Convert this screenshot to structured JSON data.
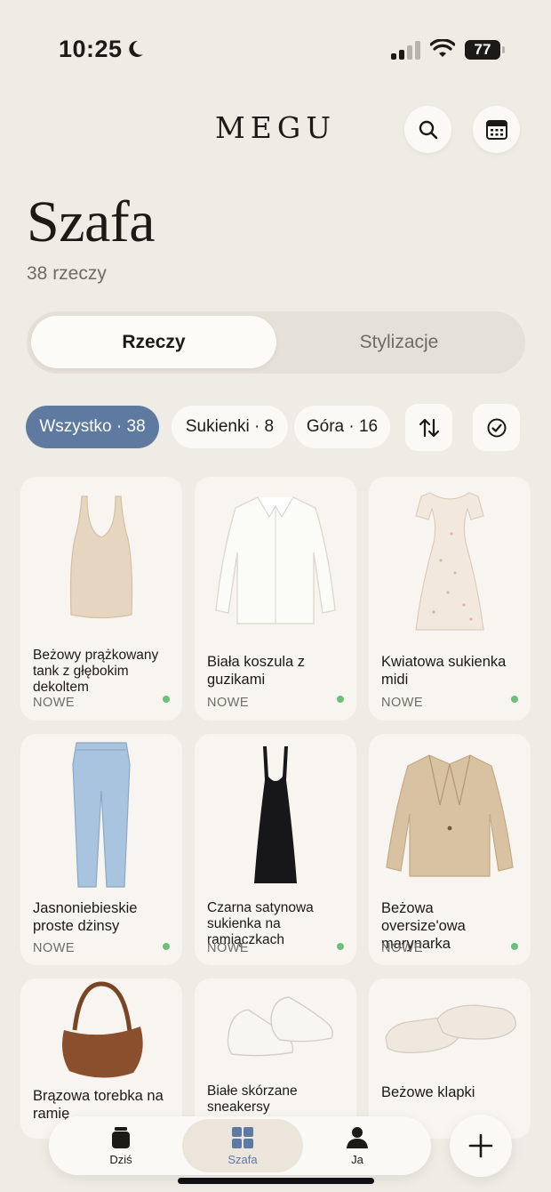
{
  "status_bar": {
    "time": "10:25",
    "battery": "77"
  },
  "header": {
    "brand": "MEGU",
    "search_icon": "search-icon",
    "calendar_icon": "calendar-icon"
  },
  "page": {
    "title": "Szafa",
    "count": "38 rzeczy"
  },
  "segments": {
    "items": "Rzeczy",
    "outfits": "Stylizacje",
    "selected": "Rzeczy"
  },
  "filters": {
    "all": "Wszystko · 38",
    "dresses": "Sukienki · 8",
    "tops": "Góra · 16",
    "sort_icon": "sort-arrows-icon",
    "select_icon": "check-circle-icon"
  },
  "colors": {
    "accent": "#5f7aa0",
    "background": "#efebe5",
    "card": "#f8f5f0",
    "new_dot": "#6cc07a"
  },
  "items": [
    {
      "name": "Beżowy prążkowany tank z głębokim dekoltem",
      "tag": "NOWE",
      "icon": "beige-tank-top"
    },
    {
      "name": "Biała koszula z guzikami",
      "tag": "NOWE",
      "icon": "white-shirt"
    },
    {
      "name": "Kwiatowa sukienka midi",
      "tag": "NOWE",
      "icon": "floral-midi-dress"
    },
    {
      "name": "Jasnoniebieskie proste dżinsy",
      "tag": "NOWE",
      "icon": "light-blue-jeans"
    },
    {
      "name": "Czarna satynowa sukienka na ramiączkach",
      "tag": "NOWE",
      "icon": "black-slip-dress"
    },
    {
      "name": "Beżowa oversize'owa marynarka",
      "tag": "NOWE",
      "icon": "beige-blazer"
    },
    {
      "name": "Brązowa torebka na ramię",
      "icon": "brown-shoulder-bag"
    },
    {
      "name": "Białe skórzane sneakersy",
      "icon": "white-sneakers"
    },
    {
      "name": "Beżowe klapki",
      "icon": "beige-slides"
    }
  ],
  "bottom_nav": {
    "today": "Dziś",
    "wardrobe": "Szafa",
    "me": "Ja",
    "selected": "Szafa"
  },
  "fab_icon": "plus-icon"
}
